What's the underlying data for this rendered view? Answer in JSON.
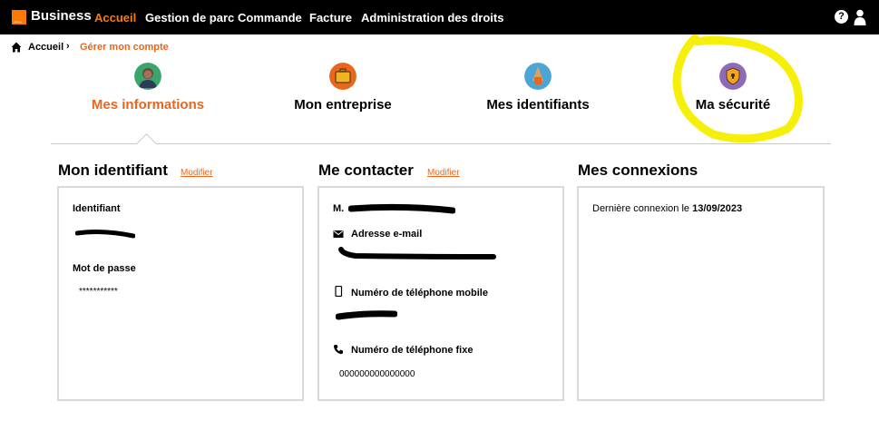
{
  "topbar": {
    "logo_text": "orange",
    "brand": "Business",
    "nav": [
      "Accueil",
      "Gestion de parc",
      "Commande",
      "Facture",
      "Administration des droits"
    ],
    "help_icon": "question-circle-icon",
    "user_icon": "user-icon"
  },
  "breadcrumb": {
    "home": "Accueil",
    "current": "Gérer mon compte"
  },
  "tabs": [
    {
      "label": "Mes informations",
      "icon": "person-avatar-icon",
      "icon_color": "#3aa66b"
    },
    {
      "label": "Mon entreprise",
      "icon": "briefcase-icon",
      "icon_color": "#e9661e"
    },
    {
      "label": "Mes identifiants",
      "icon": "identifier-icon",
      "icon_color": "#4ba6d6"
    },
    {
      "label": "Ma sécurité",
      "icon": "shield-lock-icon",
      "icon_color": "#8e6bb8"
    }
  ],
  "sections": {
    "identifiant": {
      "title": "Mon identifiant",
      "modify": "Modifier",
      "id_label": "Identifiant",
      "password_label": "Mot de passe",
      "password_value": "***********"
    },
    "contact": {
      "title": "Me contacter",
      "modify": "Modifier",
      "civility": "M.",
      "email_label": "Adresse e-mail",
      "mobile_label": "Numéro de téléphone mobile",
      "landline_label": "Numéro de téléphone fixe",
      "landline_value": "000000000000000"
    },
    "connexions": {
      "title": "Mes connexions",
      "last_label": "Dernière connexion le",
      "last_date": "13/09/2023"
    }
  },
  "colors": {
    "brand_orange": "#ff7900",
    "link_orange": "#e9661e",
    "highlight_yellow": "#f5ef0a",
    "panel_border": "#d9d9d9"
  }
}
